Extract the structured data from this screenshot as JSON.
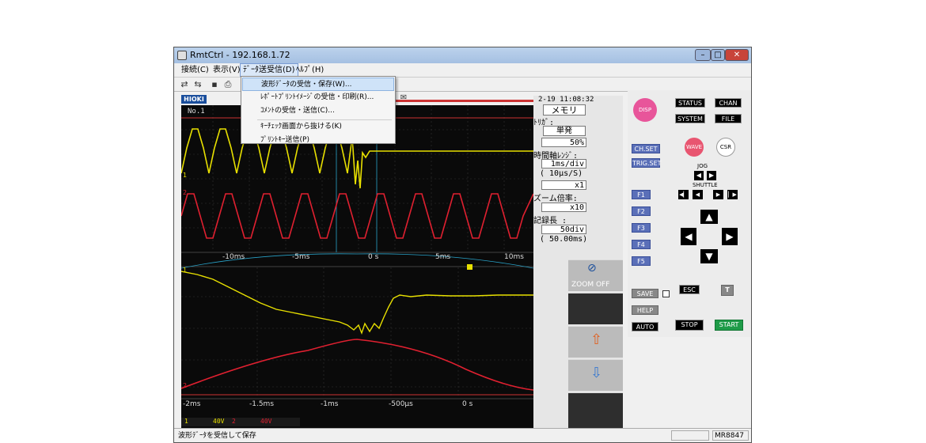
{
  "window": {
    "title": "RmtCtrl - 192.168.1.72"
  },
  "menubar": {
    "items": [
      "接続(C)",
      "表示(V)",
      "ﾃﾞｰﾀ送受信(D)",
      "ﾍﾙﾌﾟ(H)"
    ]
  },
  "menu": {
    "items": [
      "波形ﾃﾞｰﾀの受信・保存(W)...",
      "ﾚﾎﾟｰﾄﾌﾟﾘﾝﾄｲﾒｰｼﾞの受信・印刷(R)...",
      "ｺﾒﾝﾄの受信・送信(C)...",
      "ｷｰﾁｪｯｸ画面から抜ける(K)",
      "ﾌﾟﾘﾝﾄｷｰ送信(P)"
    ]
  },
  "brand": "HIOKI",
  "scope": {
    "ch_no": "No.1",
    "upper_ticks": [
      "-10ms",
      "-5ms",
      "0 s",
      "5ms",
      "10ms"
    ],
    "lower_ticks": [
      "-2ms",
      "-1.5ms",
      "-1ms",
      "-500μs",
      "0 s"
    ],
    "ch1_label": "1",
    "ch2_label": "2",
    "ch1_range": "40V",
    "ch2_range": "40V",
    "lower_ch1": "1",
    "lower_ch2": "2",
    "zoom": "ZOOM OFF"
  },
  "info": {
    "time": "2-19  11:08:32",
    "mode": "メモリ",
    "trigger_label": "ﾄﾘｶﾞ:",
    "trigger_value": "単発",
    "pretrig": "50%",
    "timeaxis_label": "時間軸ﾚﾝｼﾞ:",
    "timeaxis_value": "1ms/div",
    "sample": "(  10μs/S)",
    "mag1": "x1",
    "zoom_label": "ズーム倍率:",
    "zoom_value": "x10",
    "rec_label": "記録長 :",
    "rec_value": "50div",
    "rec_time": "( 50.00ms)"
  },
  "panel": {
    "disp": "DISP",
    "status": "STATUS",
    "chan": "CHAN",
    "system": "SYSTEM",
    "file": "FILE",
    "chset": "CH.SET",
    "trigset": "TRIG.SET",
    "wave": "WAVE",
    "csr": "CSR",
    "jog": "JOG",
    "shuttle": "SHUTTLE",
    "f1": "F1",
    "f2": "F2",
    "f3": "F3",
    "f4": "F4",
    "f5": "F5",
    "save": "SAVE",
    "help": "HELP",
    "auto": "AUTO",
    "esc": "ESC",
    "stop": "STOP",
    "start": "START",
    "t": "T"
  },
  "status": {
    "text": "波形ﾃﾞｰﾀを受信して保存",
    "model": "MR8847"
  }
}
